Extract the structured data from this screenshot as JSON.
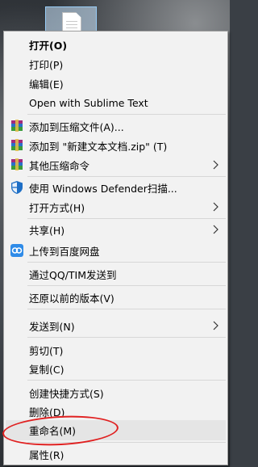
{
  "menu": {
    "open": "打开(O)",
    "print": "打印(P)",
    "edit": "编辑(E)",
    "open_sublime": "Open with Sublime Text",
    "add_to_archive": "添加到压缩文件(A)...",
    "add_to_zip": "添加到 \"新建文本文档.zip\" (T)",
    "other_compress": "其他压缩命令",
    "defender_scan": "使用 Windows Defender扫描...",
    "open_with": "打开方式(H)",
    "share": "共享(H)",
    "upload_baidu": "上传到百度网盘",
    "send_qq_tim": "通过QQ/TIM发送到",
    "restore_previous": "还原以前的版本(V)",
    "send_to": "发送到(N)",
    "cut": "剪切(T)",
    "copy": "复制(C)",
    "create_shortcut": "创建快捷方式(S)",
    "delete": "删除(D)",
    "rename": "重命名(M)",
    "properties": "属性(R)"
  },
  "icons": {
    "winrar": "winrar-icon",
    "defender": "windows-defender-shield-icon",
    "baidu": "baidu-netdisk-icon",
    "submenu": "chevron-right-icon",
    "file": "text-document-icon"
  },
  "annotation_color": "#e02020"
}
